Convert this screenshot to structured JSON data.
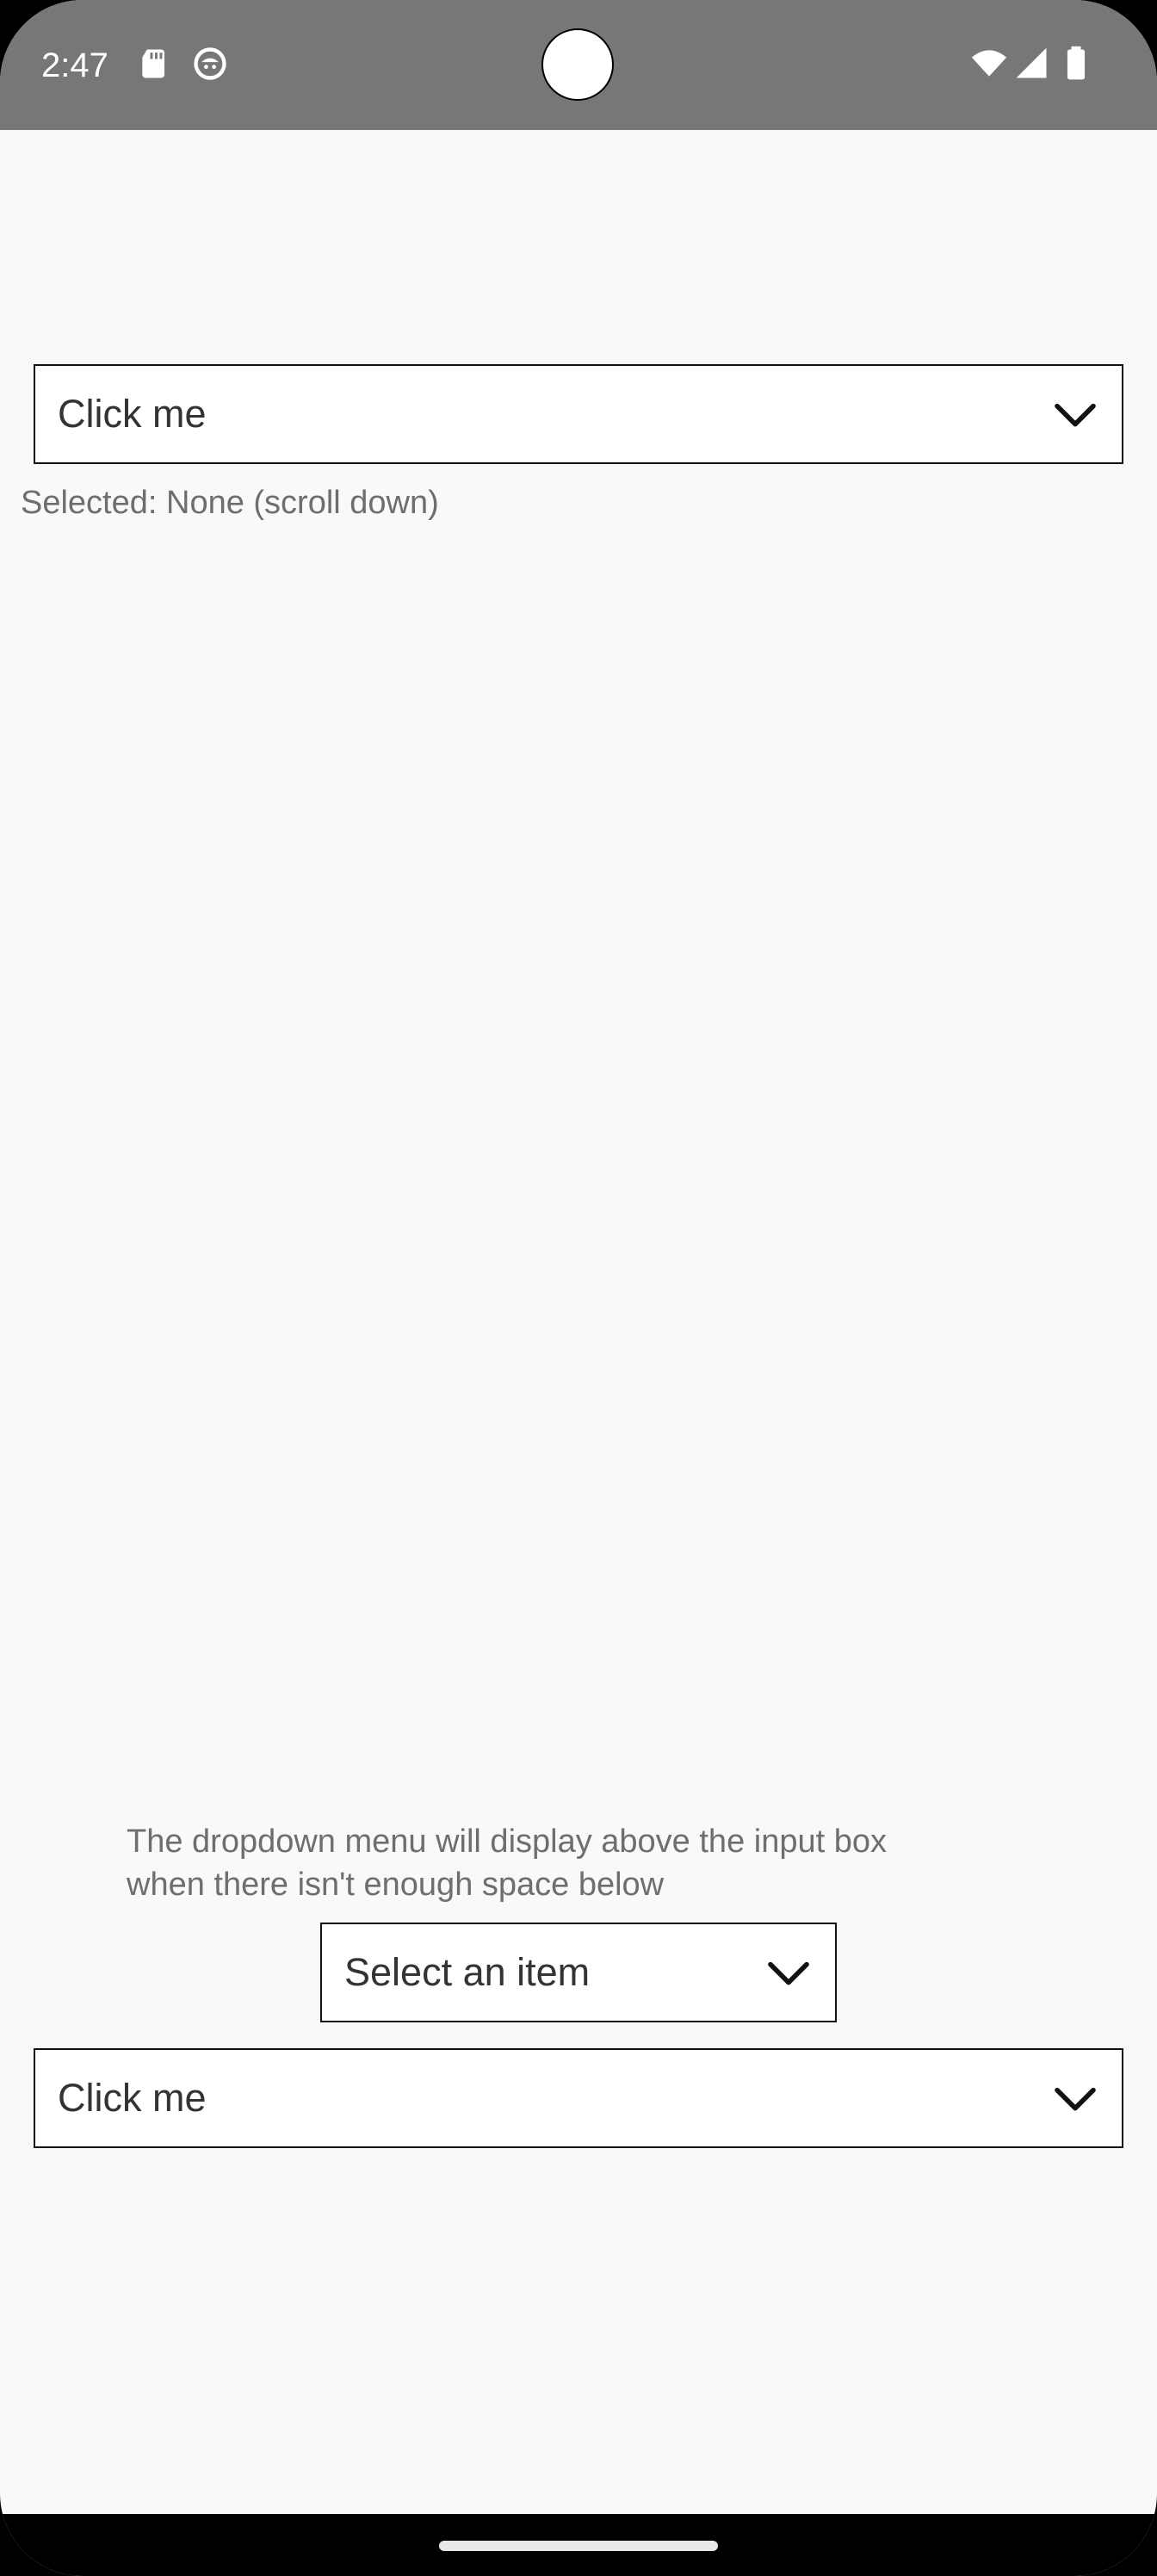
{
  "status_bar": {
    "time": "2:47",
    "icons": [
      "sd-card-icon",
      "app-notification-icon",
      "wifi-icon",
      "cell-signal-icon",
      "battery-icon"
    ],
    "background": "#777777"
  },
  "top_dropdown": {
    "label": "Click me"
  },
  "selected_status": "Selected: None (scroll down)",
  "note": {
    "line1": "The dropdown menu will display above the input box",
    "line2": "when there isn't enough space below"
  },
  "small_dropdown": {
    "label": "Select an item"
  },
  "bottom_dropdown": {
    "label": "Click me"
  },
  "colors": {
    "page_background": "#f9f9f9",
    "secondary_text": "#6e6e6e",
    "field_border": "#111111"
  }
}
